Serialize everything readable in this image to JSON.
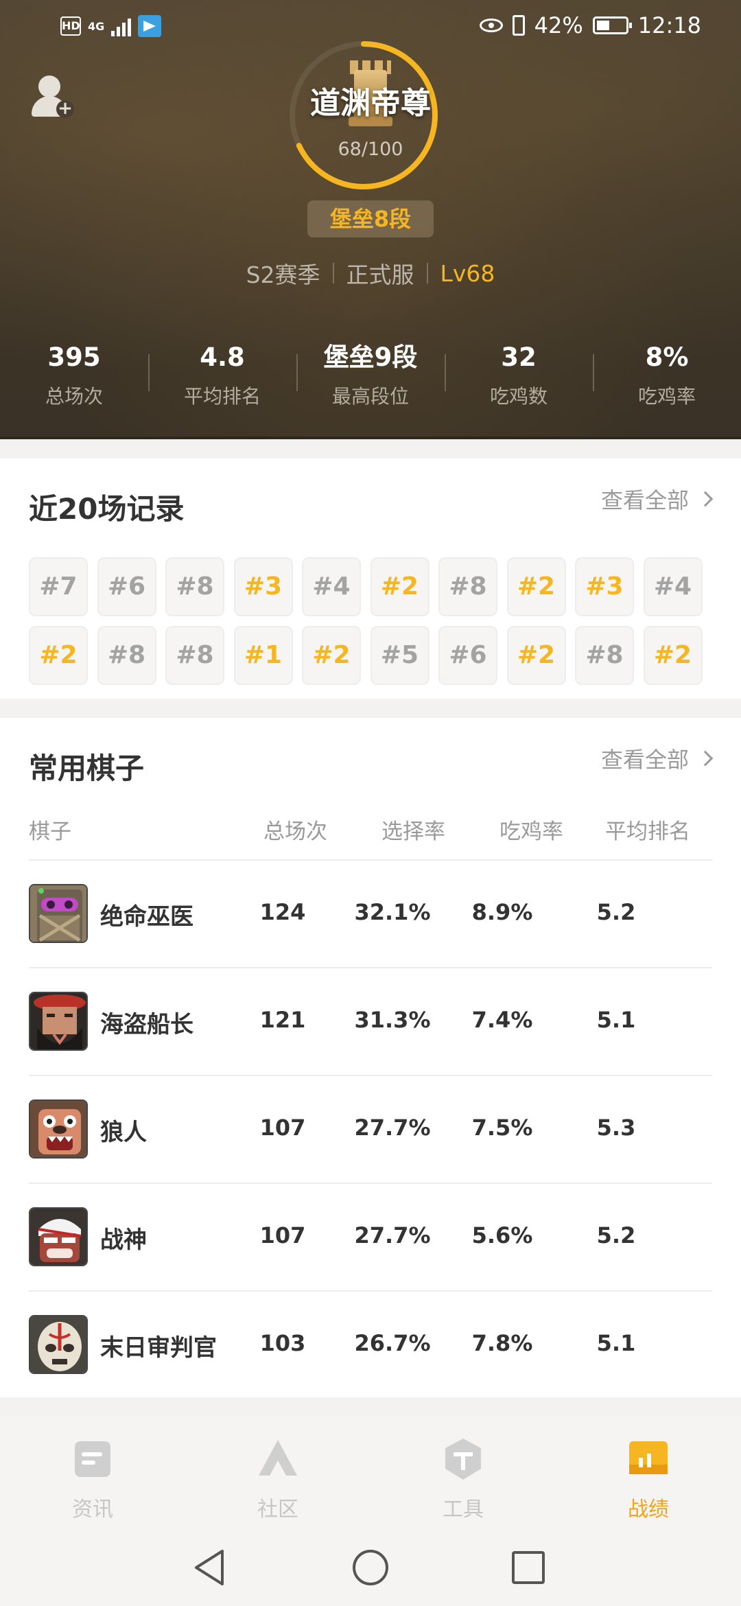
{
  "status_bar": {
    "network": "4G",
    "battery": "42%",
    "time": "12:18"
  },
  "header": {
    "player_name": "道渊帝尊",
    "progress_text": "68/100",
    "progress_value": 0.68,
    "rank": "堡垒8段",
    "season": "S2赛季",
    "server": "正式服",
    "level": "Lv68"
  },
  "stats": [
    {
      "value": "395",
      "label": "总场次"
    },
    {
      "value": "4.8",
      "label": "平均排名"
    },
    {
      "value": "堡垒9段",
      "label": "最高段位"
    },
    {
      "value": "32",
      "label": "吃鸡数"
    },
    {
      "value": "8%",
      "label": "吃鸡率"
    }
  ],
  "recent": {
    "title": "近20场记录",
    "view_all": "查看全部",
    "results": [
      "#7",
      "#6",
      "#8",
      "#3",
      "#4",
      "#2",
      "#8",
      "#2",
      "#3",
      "#4",
      "#2",
      "#8",
      "#8",
      "#1",
      "#2",
      "#5",
      "#6",
      "#2",
      "#8",
      "#2"
    ],
    "highlight_color": "#f6b622"
  },
  "pieces": {
    "title": "常用棋子",
    "view_all": "查看全部",
    "headers": [
      "棋子",
      "总场次",
      "选择率",
      "吃鸡率",
      "平均排名"
    ],
    "rows": [
      {
        "name": "绝命巫医",
        "games": "124",
        "pick": "32.1%",
        "win": "8.9%",
        "avg": "5.2",
        "icon": "witch-doctor-avatar"
      },
      {
        "name": "海盗船长",
        "games": "121",
        "pick": "31.3%",
        "win": "7.4%",
        "avg": "5.1",
        "icon": "pirate-captain-avatar"
      },
      {
        "name": "狼人",
        "games": "107",
        "pick": "27.7%",
        "win": "7.5%",
        "avg": "5.3",
        "icon": "werewolf-avatar"
      },
      {
        "name": "战神",
        "games": "107",
        "pick": "27.7%",
        "win": "5.6%",
        "avg": "5.2",
        "icon": "war-god-avatar"
      },
      {
        "name": "末日审判官",
        "games": "103",
        "pick": "26.7%",
        "win": "7.8%",
        "avg": "5.1",
        "icon": "doom-arbiter-avatar"
      }
    ]
  },
  "nav": [
    {
      "label": "资讯",
      "icon": "news-icon"
    },
    {
      "label": "社区",
      "icon": "community-icon"
    },
    {
      "label": "工具",
      "icon": "tools-icon"
    },
    {
      "label": "战绩",
      "icon": "record-icon",
      "active": true
    }
  ],
  "colors": {
    "accent": "#f6b622",
    "active_nav": "#f0a417"
  }
}
